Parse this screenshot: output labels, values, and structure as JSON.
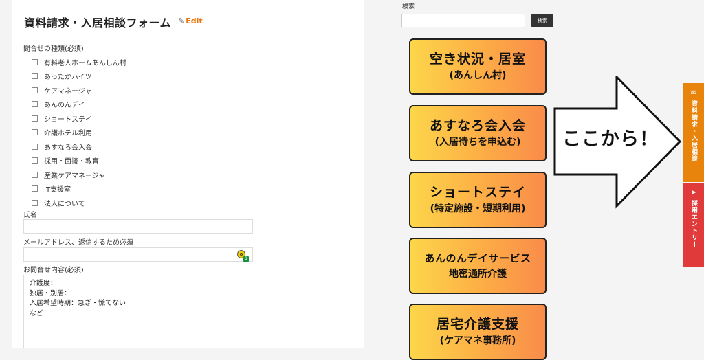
{
  "form": {
    "title": "資料請求・入居相談フォーム",
    "edit_label": "Edit",
    "inquiry_type_label": "問合せの種類(必須)",
    "inquiry_types": [
      {
        "label": "有料老人ホームあんしん村"
      },
      {
        "label": "あったかハイツ"
      },
      {
        "label": "ケアマネージャ"
      },
      {
        "label": "あんのんデイ"
      },
      {
        "label": "ショートステイ"
      },
      {
        "label": "介護ホテル利用"
      },
      {
        "label": "あすなろ会入会"
      },
      {
        "label": "採用・面接・教育"
      },
      {
        "label": "産業ケアマネージャ"
      },
      {
        "label": "IT支援室"
      },
      {
        "label": "法人について"
      }
    ],
    "name_label": "氏名",
    "name_value": "",
    "email_label": "メールアドレス、返信するため必須",
    "email_value": "",
    "password_manager_badge": "1",
    "message_label": "お問合せ内容(必須)",
    "message_lines": [
      "介護度：",
      "独居・別居：",
      "入居希望時期：急ぎ・慌てない",
      "など"
    ]
  },
  "search": {
    "label": "検索",
    "value": "",
    "button_label": "検索"
  },
  "banners": [
    {
      "main": "空き状況・居室",
      "sub": "(あんしん村)"
    },
    {
      "main": "あすなろ会入会",
      "sub": "(入居待ちを申込む)"
    },
    {
      "main": "ショートステイ",
      "sub": "(特定施設・短期利用)"
    },
    {
      "main": "あんのんデイサービス",
      "sub": "地密通所介護"
    },
    {
      "main": "居宅介護支援",
      "sub": "(ケアマネ事務所)"
    }
  ],
  "arrow": {
    "text": "ここから！"
  },
  "side_tabs": {
    "contact": {
      "label": "資料請求・入居相談",
      "icon": "envelope-icon",
      "color": "#e8830c"
    },
    "recruit": {
      "label": "採用エントリー",
      "icon": "paper-plane-icon",
      "color": "#e03a3a"
    }
  }
}
